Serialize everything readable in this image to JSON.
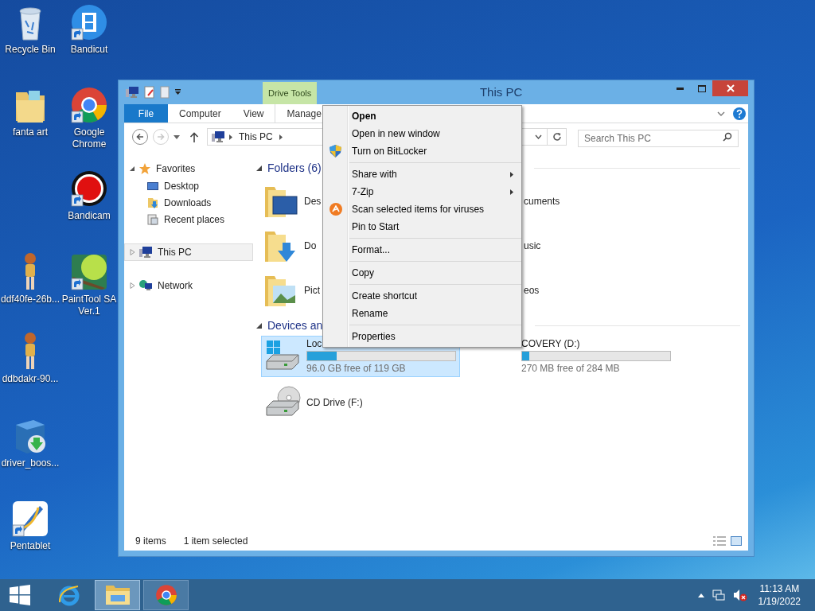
{
  "desktop": {
    "icons": [
      {
        "lines": [
          "Recycle Bin"
        ],
        "kind": "recycle-bin",
        "shortcut": false
      },
      {
        "lines": [
          "Bandicut"
        ],
        "kind": "video-app",
        "shortcut": true
      },
      {
        "lines": [
          "fanta art"
        ],
        "kind": "folder",
        "shortcut": false
      },
      {
        "lines": [
          "Google",
          "Chrome"
        ],
        "kind": "browser",
        "shortcut": true
      },
      {
        "lines": [
          "Bandicam"
        ],
        "kind": "recorder",
        "shortcut": true
      },
      {
        "lines": [
          "ddf40fe-26b..."
        ],
        "kind": "picture",
        "shortcut": false
      },
      {
        "lines": [
          "PaintTool SA",
          "Ver.1"
        ],
        "kind": "paint-app",
        "shortcut": true
      },
      {
        "lines": [
          "ddbdakr-90..."
        ],
        "kind": "picture",
        "shortcut": false
      },
      {
        "lines": [
          "driver_boos..."
        ],
        "kind": "installer",
        "shortcut": false
      },
      {
        "lines": [
          "Pentablet"
        ],
        "kind": "pen-app",
        "shortcut": true
      }
    ]
  },
  "window": {
    "title": "This PC",
    "context_tab": "Drive Tools",
    "ribbon_tabs": [
      {
        "label": "File",
        "kind": "file"
      },
      {
        "label": "Computer",
        "kind": "tab"
      },
      {
        "label": "View",
        "kind": "tab"
      },
      {
        "label": "Manage",
        "kind": "context"
      }
    ],
    "address": {
      "path": [
        "This PC"
      ]
    },
    "search": {
      "placeholder": "Search This PC"
    },
    "forward_disabled": true,
    "nav": [
      {
        "label": "Favorites",
        "kind": "star",
        "expanded": true,
        "selected": false,
        "children": [
          {
            "label": "Desktop",
            "kind": "desktop",
            "selected": false
          },
          {
            "label": "Downloads",
            "kind": "downloads",
            "selected": false
          },
          {
            "label": "Recent places",
            "kind": "recent",
            "selected": false
          }
        ]
      },
      {
        "label": "This PC",
        "kind": "pc",
        "expanded": false,
        "selected": true
      },
      {
        "label": "Network",
        "kind": "network",
        "expanded": false,
        "selected": false
      }
    ],
    "folders": {
      "title": "Folders (6)",
      "expanded": true,
      "items": [
        {
          "label": "Des",
          "kind": "desktop"
        },
        {
          "label": "cuments"
        },
        {
          "label": "Do",
          "kind": "downloads"
        },
        {
          "label": "usic"
        },
        {
          "label": "Pict",
          "kind": "pictures"
        },
        {
          "label": "eos"
        }
      ]
    },
    "devices": {
      "title": "Devices an",
      "expanded": true,
      "items": [
        {
          "label": "Loc",
          "kind": "system-drive",
          "level": 0.2,
          "free": "96.0 GB free of 119 GB",
          "selected": true
        },
        {
          "label": "COVERY (D:)",
          "level": 0.05,
          "free": "270 MB free of 284 MB",
          "selected": false
        },
        {
          "label": "CD Drive (F:)",
          "kind": "cd-drive",
          "selected": false
        }
      ]
    },
    "status_bar": [
      "9 items",
      "1 item selected"
    ]
  },
  "context_menu": {
    "groups": [
      [
        {
          "label": "Open",
          "default": true
        },
        {
          "label": "Open in new window"
        },
        {
          "label": "Turn on BitLocker",
          "kind": "shield"
        }
      ],
      [
        {
          "label": "Share with",
          "submenu": true
        },
        {
          "label": "7-Zip",
          "submenu": true
        },
        {
          "label": "Scan selected items for viruses",
          "kind": "antivirus"
        },
        {
          "label": "Pin to Start"
        }
      ],
      [
        {
          "label": "Format..."
        }
      ],
      [
        {
          "label": "Copy"
        }
      ],
      [
        {
          "label": "Create shortcut"
        },
        {
          "label": "Rename"
        }
      ],
      [
        {
          "label": "Properties"
        }
      ]
    ]
  },
  "taskbar": {
    "apps": [
      {
        "kind": "browser-ie",
        "active": false
      },
      {
        "kind": "explorer",
        "active": true
      },
      {
        "kind": "browser",
        "active": false
      }
    ],
    "time": "11:13 AM",
    "date": "1/19/2022",
    "volume_muted": true
  }
}
